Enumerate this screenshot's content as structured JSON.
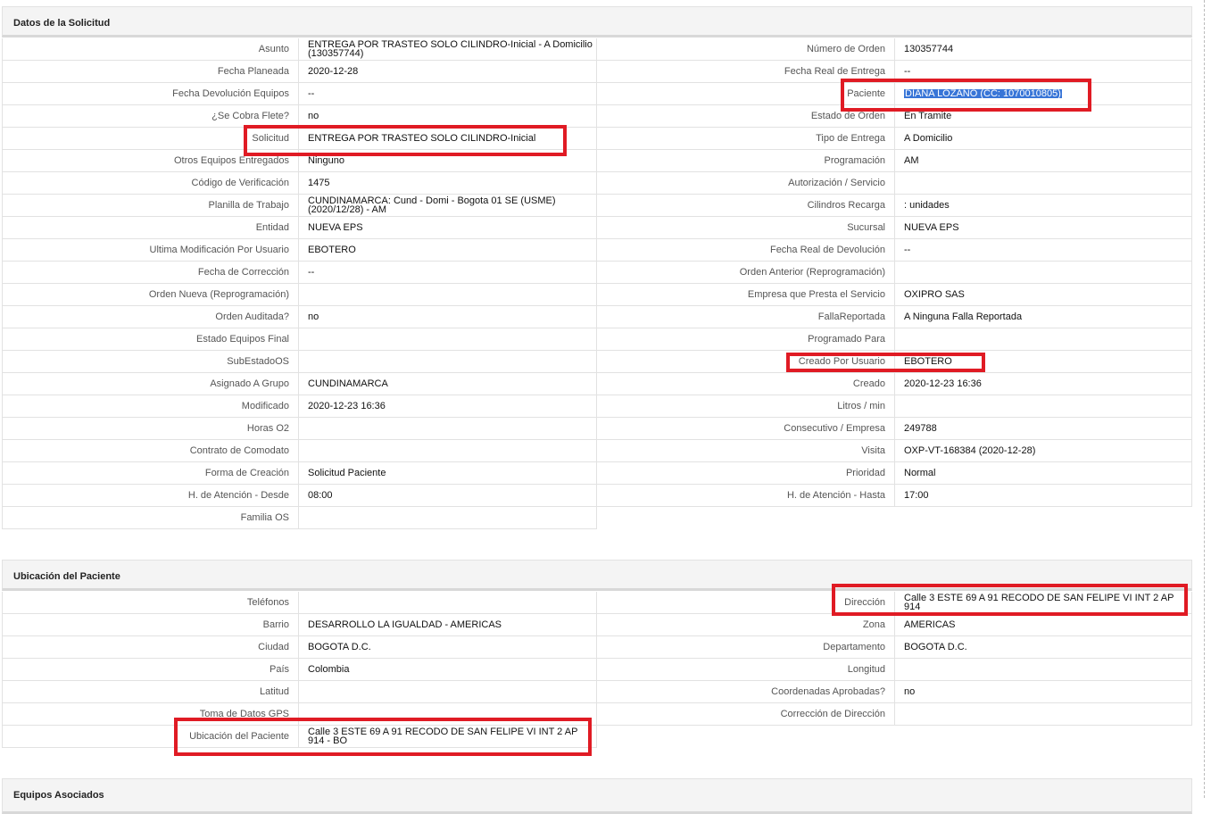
{
  "sections": {
    "solicitud_title": "Datos de la Solicitud",
    "ubicacion_title": "Ubicación del Paciente",
    "equipos_title": "Equipos Asociados"
  },
  "solicitud": {
    "left": [
      {
        "label": "Asunto",
        "value": "ENTREGA POR TRASTEO SOLO CILINDRO-Inicial - A Domicilio (130357744)"
      },
      {
        "label": "Fecha Planeada",
        "value": "2020-12-28"
      },
      {
        "label": "Fecha Devolución Equipos",
        "value": "--"
      },
      {
        "label": "¿Se Cobra Flete?",
        "value": "no"
      },
      {
        "label": "Solicitud",
        "value": "ENTREGA POR TRASTEO SOLO CILINDRO-Inicial"
      },
      {
        "label": "Otros Equipos Entregados",
        "value": "Ninguno"
      },
      {
        "label": "Código de Verificación",
        "value": "1475"
      },
      {
        "label": "Planilla de Trabajo",
        "value": "CUNDINAMARCA: Cund - Domi - Bogota 01 SE (USME) (2020/12/28) - AM"
      },
      {
        "label": "Entidad",
        "value": "NUEVA EPS"
      },
      {
        "label": "Ultima Modificación Por Usuario",
        "value": "EBOTERO"
      },
      {
        "label": "Fecha de Corrección",
        "value": "--"
      },
      {
        "label": "Orden Nueva (Reprogramación)",
        "value": ""
      },
      {
        "label": "Orden Auditada?",
        "value": "no"
      },
      {
        "label": "Estado Equipos Final",
        "value": ""
      },
      {
        "label": "SubEstadoOS",
        "value": ""
      },
      {
        "label": "Asignado A Grupo",
        "value": "CUNDINAMARCA"
      },
      {
        "label": "Modificado",
        "value": "2020-12-23 16:36"
      },
      {
        "label": "Horas O2",
        "value": ""
      },
      {
        "label": "Contrato de Comodato",
        "value": ""
      },
      {
        "label": "Forma de Creación",
        "value": "Solicitud Paciente"
      },
      {
        "label": "H. de Atención - Desde",
        "value": "08:00"
      },
      {
        "label": "Familia OS",
        "value": ""
      }
    ],
    "right": [
      {
        "label": "Número de Orden",
        "value": "130357744"
      },
      {
        "label": "Fecha Real de Entrega",
        "value": "--"
      },
      {
        "label": "Paciente",
        "value": "DIANA LOZANO (CC: 1070010805)"
      },
      {
        "label": "Estado de Orden",
        "value": "En Tramite"
      },
      {
        "label": "Tipo de Entrega",
        "value": "A Domicilio"
      },
      {
        "label": "Programación",
        "value": "AM"
      },
      {
        "label": "Autorización / Servicio",
        "value": ""
      },
      {
        "label": "Cilindros Recarga",
        "value": ": unidades"
      },
      {
        "label": "Sucursal",
        "value": "NUEVA EPS"
      },
      {
        "label": "Fecha Real de Devolución",
        "value": "--"
      },
      {
        "label": "Orden Anterior (Reprogramación)",
        "value": ""
      },
      {
        "label": "Empresa que Presta el Servicio",
        "value": "OXIPRO SAS"
      },
      {
        "label": "FallaReportada",
        "value": "A Ninguna Falla Reportada"
      },
      {
        "label": "Programado Para",
        "value": ""
      },
      {
        "label": "Creado Por Usuario",
        "value": "EBOTERO"
      },
      {
        "label": "Creado",
        "value": "2020-12-23 16:36"
      },
      {
        "label": "Litros / min",
        "value": ""
      },
      {
        "label": "Consecutivo / Empresa",
        "value": "249788"
      },
      {
        "label": "Visita",
        "value": "OXP-VT-168384 (2020-12-28)"
      },
      {
        "label": "Prioridad",
        "value": "Normal"
      },
      {
        "label": "H. de Atención - Hasta",
        "value": "17:00"
      }
    ]
  },
  "ubicacion": {
    "left": [
      {
        "label": "Teléfonos",
        "value": ""
      },
      {
        "label": "Barrio",
        "value": "DESARROLLO LA IGUALDAD - AMERICAS"
      },
      {
        "label": "Ciudad",
        "value": "BOGOTA D.C."
      },
      {
        "label": "País",
        "value": "Colombia"
      },
      {
        "label": "Latitud",
        "value": ""
      },
      {
        "label": "Toma de Datos GPS",
        "value": ""
      },
      {
        "label": "Ubicación del Paciente",
        "value": "Calle 3 ESTE 69 A 91 RECODO DE SAN FELIPE VI INT 2 AP 914 - BO"
      }
    ],
    "right": [
      {
        "label": "Dirección",
        "value": "Calle 3 ESTE 69 A 91 RECODO DE SAN FELIPE VI INT 2 AP 914"
      },
      {
        "label": "Zona",
        "value": "AMERICAS"
      },
      {
        "label": "Departamento",
        "value": "BOGOTA D.C."
      },
      {
        "label": "Longitud",
        "value": ""
      },
      {
        "label": "Coordenadas Aprobadas?",
        "value": "no"
      },
      {
        "label": "Corrección de Dirección",
        "value": ""
      }
    ]
  },
  "colors": {
    "highlight": "#e01b24",
    "selection": "#3875d7"
  }
}
